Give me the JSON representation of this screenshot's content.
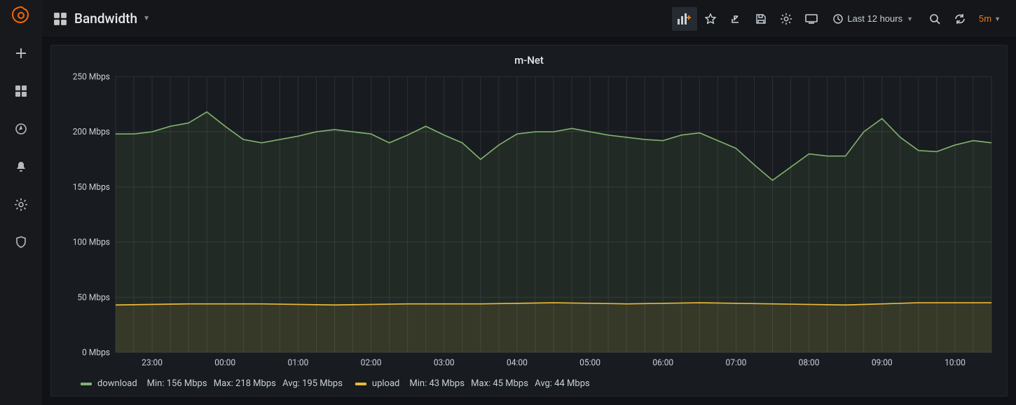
{
  "header": {
    "title": "Bandwidth",
    "time_range_label": "Last 12 hours",
    "refresh_interval": "5m"
  },
  "panel": {
    "title": "m-Net"
  },
  "legend": {
    "download": {
      "name": "download",
      "min": "Min: 156 Mbps",
      "max": "Max: 218 Mbps",
      "avg": "Avg: 195 Mbps",
      "color": "#7eb26d"
    },
    "upload": {
      "name": "upload",
      "min": "Min: 43 Mbps",
      "max": "Max: 45 Mbps",
      "avg": "Avg: 44 Mbps",
      "color": "#eab839"
    }
  },
  "chart_data": {
    "type": "line",
    "title": "m-Net",
    "xlabel": "",
    "ylabel": "",
    "ylim": [
      0,
      250
    ],
    "y_ticks": [
      0,
      50,
      100,
      150,
      200,
      250
    ],
    "y_tick_labels": [
      "0 Mbps",
      "50 Mbps",
      "100 Mbps",
      "150 Mbps",
      "200 Mbps",
      "250 Mbps"
    ],
    "x_tick_labels": [
      "23:00",
      "00:00",
      "01:00",
      "02:00",
      "03:00",
      "04:00",
      "05:00",
      "06:00",
      "07:00",
      "08:00",
      "09:00",
      "10:00"
    ],
    "x_tick_positions": [
      1,
      3,
      5,
      7,
      9,
      11,
      13,
      15,
      17,
      19,
      21,
      23
    ],
    "x": [
      0,
      1,
      2,
      3,
      4,
      5,
      6,
      7,
      8,
      9,
      10,
      11,
      12,
      13,
      14,
      15,
      16,
      17,
      18,
      19,
      20,
      21,
      22,
      23,
      24
    ],
    "series": [
      {
        "name": "download",
        "color": "#7eb26d",
        "values": [
          198,
          198,
          205,
          218,
          200,
          190,
          196,
          202,
          199,
          190,
          205,
          190,
          175,
          198,
          200,
          203,
          197,
          195,
          192,
          199,
          185,
          156,
          180,
          178,
          212
        ]
      },
      {
        "name": "download_tail",
        "color": "#7eb26d",
        "values_extra_x": [
          24,
          25,
          26,
          27,
          28,
          29
        ],
        "values_extra_y": [
          212,
          190,
          182,
          192,
          188,
          180
        ]
      },
      {
        "name": "upload",
        "color": "#eab839",
        "values": [
          43,
          43,
          44,
          44,
          44,
          43,
          44,
          44,
          44,
          44,
          44,
          44,
          45,
          45,
          44,
          44,
          45,
          44,
          44,
          44,
          44,
          43,
          44,
          45,
          45
        ]
      }
    ],
    "download_full_x": [
      0,
      1,
      2,
      3,
      4,
      5,
      6,
      7,
      8,
      9,
      10,
      11,
      12,
      13,
      14,
      15,
      16,
      17,
      18,
      19,
      20,
      21,
      22,
      23,
      24,
      25,
      26,
      27,
      28,
      29
    ],
    "download_full_y": [
      198,
      198,
      205,
      218,
      200,
      190,
      196,
      202,
      199,
      190,
      205,
      190,
      175,
      198,
      200,
      203,
      197,
      195,
      192,
      199,
      185,
      156,
      180,
      178,
      212,
      190,
      182,
      192,
      188,
      180
    ],
    "upload_full_x": [
      0,
      1,
      2,
      3,
      4,
      5,
      6,
      7,
      8,
      9,
      10,
      11,
      12,
      13,
      14,
      15,
      16,
      17,
      18,
      19,
      20,
      21,
      22,
      23,
      24,
      25,
      26,
      27,
      28,
      29
    ],
    "upload_full_y": [
      43,
      43,
      44,
      44,
      44,
      43,
      44,
      44,
      44,
      44,
      44,
      44,
      45,
      45,
      44,
      44,
      45,
      44,
      44,
      44,
      44,
      43,
      44,
      45,
      45,
      45,
      44,
      45,
      45,
      45
    ],
    "download_render": {
      "x": [
        0,
        0.5,
        1,
        1.5,
        2,
        2.5,
        3,
        3.5,
        4,
        4.5,
        5,
        5.5,
        6,
        6.5,
        7,
        7.5,
        8,
        8.5,
        9,
        9.5,
        10,
        10.5,
        11,
        11.5,
        12,
        12.5,
        13,
        13.5,
        14,
        14.5,
        15,
        15.5,
        16,
        16.5,
        17,
        17.5
      ],
      "y": [
        198,
        198,
        200,
        205,
        208,
        218,
        205,
        193,
        190,
        193,
        196,
        200,
        202,
        200,
        198,
        190,
        197,
        205,
        197,
        190,
        175,
        188,
        198,
        200,
        200,
        203,
        200,
        197,
        195,
        193,
        192,
        197,
        199,
        192,
        185,
        170
      ]
    },
    "download_render_tail": {
      "x": [
        17.5,
        18,
        18.5,
        19,
        19.5,
        20,
        20.5,
        21,
        21.5,
        22,
        22.5,
        23,
        23.5,
        24
      ],
      "y": [
        170,
        156,
        168,
        180,
        178,
        178,
        200,
        212,
        195,
        183,
        182,
        188,
        192,
        190
      ]
    },
    "upload_render": {
      "x": [
        0,
        24
      ],
      "y": [
        43,
        45
      ]
    }
  }
}
